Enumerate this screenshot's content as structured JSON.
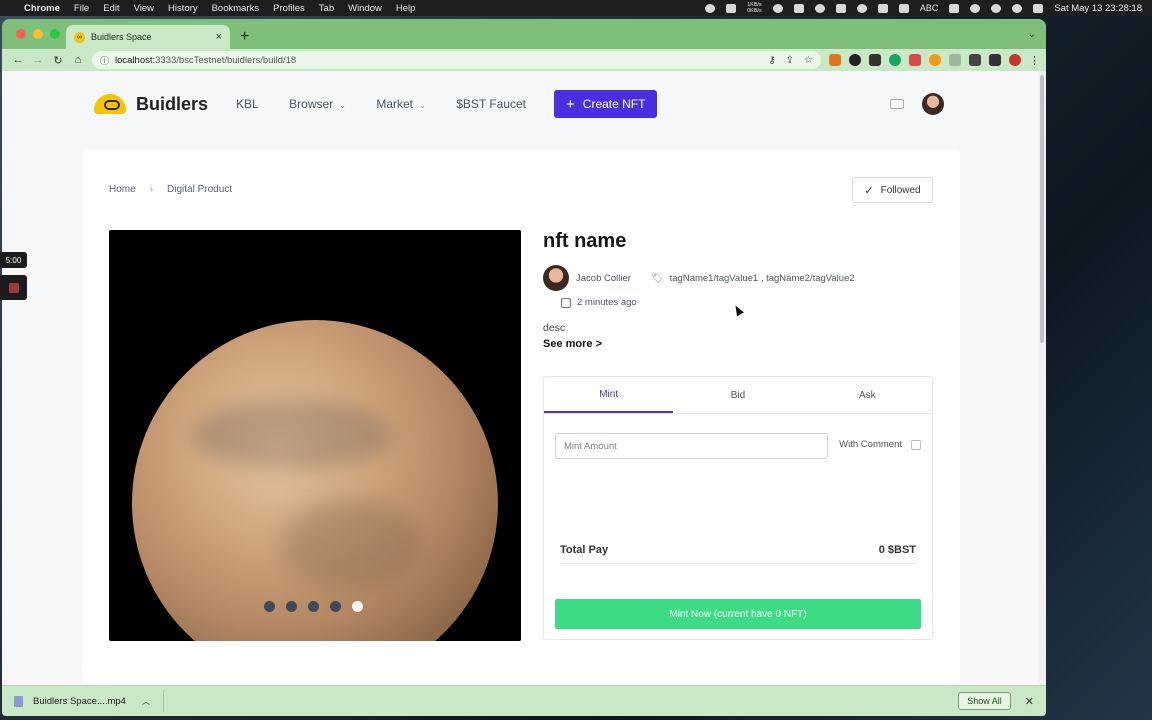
{
  "menubar": {
    "app": "Chrome",
    "items": [
      "File",
      "Edit",
      "View",
      "History",
      "Bookmarks",
      "Profiles",
      "Tab",
      "Window",
      "Help"
    ],
    "net_up": "1KB/s",
    "net_down": "0KB/s",
    "input_source": "ABC",
    "datetime": "Sat May 13  23:28:18"
  },
  "browser": {
    "tab_title": "Buidlers Space",
    "url_host": "localhost",
    "url_path": ":3333/bscTestnet/buidlers/build/18"
  },
  "header": {
    "brand": "Buidlers",
    "nav": [
      {
        "label": "KBL",
        "has_caret": false
      },
      {
        "label": "Browser",
        "has_caret": true
      },
      {
        "label": "Market",
        "has_caret": true
      },
      {
        "label": "$BST Faucet",
        "has_caret": false
      }
    ],
    "create_label": "Create NFT"
  },
  "breadcrumb": {
    "home": "Home",
    "current": "Digital Product"
  },
  "follow_label": "Followed",
  "nft": {
    "name": "nft name",
    "author": "Jacob Collier",
    "tags": "tagName1/tagValue1 , tagName2/tagValue2",
    "time": "2 minutes ago",
    "desc": "desc",
    "see_more": "See more >",
    "carousel_count": 5,
    "carousel_active": 4
  },
  "panel": {
    "tabs": [
      "Mint",
      "Bid",
      "Ask"
    ],
    "active_tab": 0,
    "mint_placeholder": "Mint Amount",
    "comment_label": "With Comment",
    "total_label": "Total Pay",
    "total_value": "0 $BST",
    "mint_button": "Mint Now (current have 0 NFT)"
  },
  "downloads": {
    "file": "Buidlers Space....mp4",
    "show_all": "Show All"
  },
  "recorder": {
    "time": "5:00"
  },
  "colors": {
    "accent": "#4a2fe0",
    "mint_green": "#3ddc84",
    "chrome_green": "#7ec07a"
  }
}
